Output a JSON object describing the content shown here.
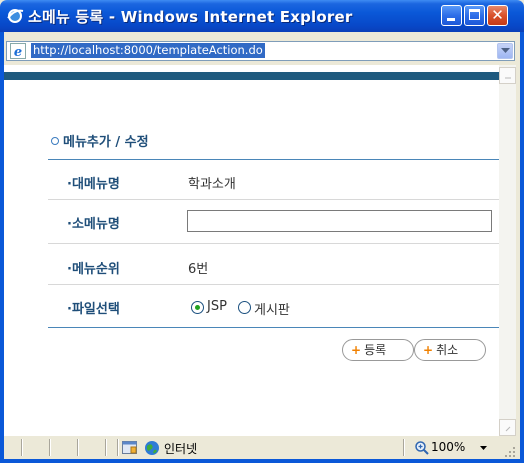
{
  "window": {
    "title": "소메뉴 등록 - Windows Internet Explorer",
    "address_url": "http://localhost:8000/templateAction.do"
  },
  "form": {
    "section_title": "메뉴추가 / 수정",
    "rows": [
      {
        "label": "·대메뉴명",
        "value": "학과소개"
      },
      {
        "label": "·소메뉴명",
        "value": ""
      },
      {
        "label": "·메뉴순위",
        "value": "6번"
      },
      {
        "label": "·파일선택",
        "value": ""
      }
    ],
    "file_options": [
      {
        "label": "JSP",
        "selected": true
      },
      {
        "label": "게시판",
        "selected": false
      }
    ],
    "buttons": {
      "register": "등록",
      "cancel": "취소"
    }
  },
  "status": {
    "zone": "인터넷",
    "zoom": "100%"
  },
  "colors": {
    "titlebar": "#0a58d8",
    "close_button": "#d9512c",
    "accent_stripe": "#1f5a7e",
    "label_text": "#1f4e79",
    "radio_dot": "#21a121",
    "button_plus": "#f08000"
  }
}
